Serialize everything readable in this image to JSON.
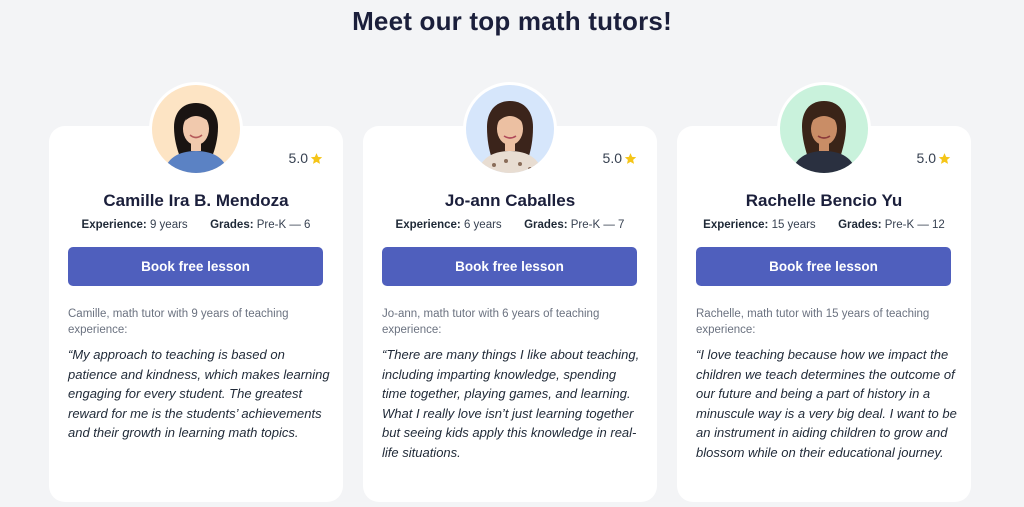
{
  "heading": "Meet our top math tutors!",
  "colors": {
    "button": "#4f5fbd",
    "star": "#f5c518",
    "background": "#f3f4f6"
  },
  "tutors": [
    {
      "name": "Camille Ira B. Mendoza",
      "rating": "5.0",
      "experience_label": "Experience:",
      "experience_value": "9 years",
      "grades_label": "Grades:",
      "grades_value": "Pre-K — 6",
      "button_label": "Book free lesson",
      "intro": "Camille, math tutor with 9 years of teaching experience:",
      "quote": "“My approach to teaching is based on patience and kindness, which makes learning engaging for every student. The greatest reward for me is the students’ achievements and their growth in learning math topics.",
      "avatar_bg": "#fde4c4"
    },
    {
      "name": "Jo-ann Caballes",
      "rating": "5.0",
      "experience_label": "Experience:",
      "experience_value": "6 years",
      "grades_label": "Grades:",
      "grades_value": "Pre-K — 7",
      "button_label": "Book free lesson",
      "intro": "Jo-ann, math tutor with 6 years of teaching experience:",
      "quote": "“There are many things I like about teaching, including imparting knowledge, spending time together, playing games, and learning. What I really love isn’t just learning together but seeing kids apply this knowledge in real-life situations.",
      "avatar_bg": "#d6e6fb"
    },
    {
      "name": "Rachelle Bencio Yu",
      "rating": "5.0",
      "experience_label": "Experience:",
      "experience_value": "15 years",
      "grades_label": "Grades:",
      "grades_value": "Pre-K — 12",
      "button_label": "Book free lesson",
      "intro": "Rachelle, math tutor with 15 years of teaching experience:",
      "quote": "“I love teaching because how we impact the children we teach determines the outcome of our future and being a part of history in a minuscule way is a very big deal. I want to be an instrument in aiding children to grow and blossom while on their educational journey.",
      "avatar_bg": "#c9f2dc"
    }
  ]
}
